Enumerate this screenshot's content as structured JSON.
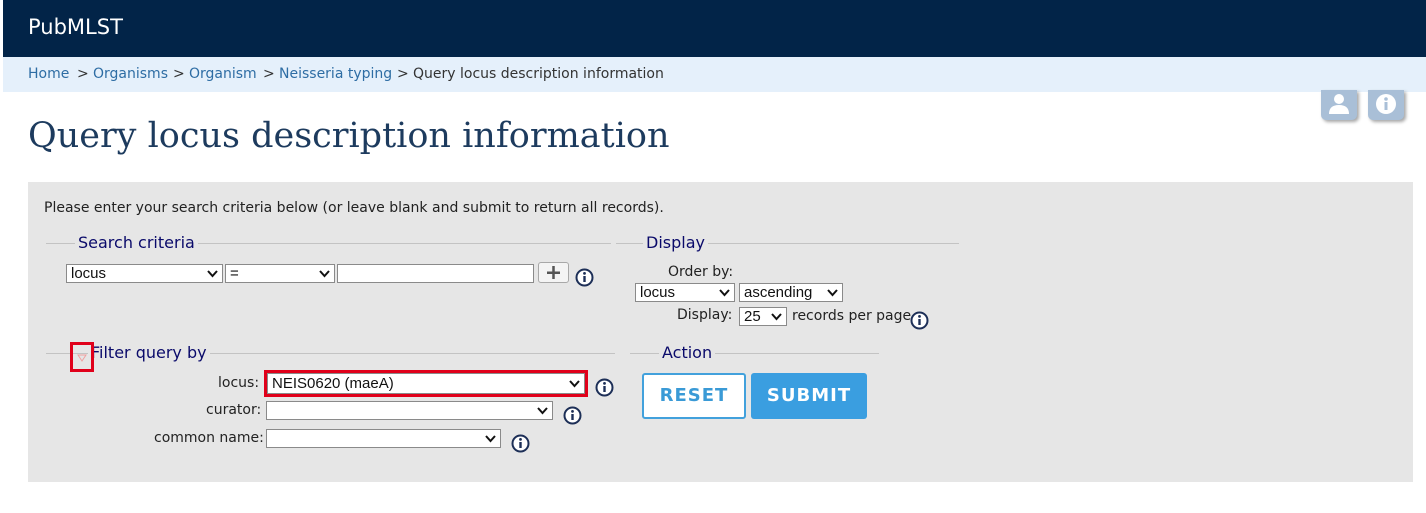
{
  "header": {
    "site_name": "PubMLST"
  },
  "breadcrumb": {
    "items": [
      "Home",
      "Organisms",
      "Organism",
      "Neisseria typing"
    ],
    "separator": ">",
    "current": "Query locus description information"
  },
  "top_icons": [
    "user-icon",
    "info-icon"
  ],
  "page_title": "Query locus description information",
  "instructions": "Please enter your search criteria below (or leave blank and submit to return all records).",
  "search_criteria": {
    "legend": "Search criteria",
    "field_select": "locus",
    "operator_select": "=",
    "value_input": "",
    "add_button_icon": "plus-icon"
  },
  "display": {
    "legend": "Display",
    "order_by_label": "Order by:",
    "order_by_value": "locus",
    "direction_value": "ascending",
    "display_label": "Display:",
    "per_page_value": "25",
    "per_page_suffix": "records per page"
  },
  "filter": {
    "legend": "Filter query by",
    "locus_label": "locus:",
    "locus_value": "NEIS0620 (maeA)",
    "curator_label": "curator:",
    "curator_value": "",
    "common_name_label": "common name:",
    "common_name_value": ""
  },
  "action": {
    "legend": "Action",
    "reset_label": "RESET",
    "submit_label": "SUBMIT"
  },
  "colors": {
    "header_bg": "#022448",
    "breadcrumb_bg": "#e5f0fb",
    "link": "#2e6da4",
    "title": "#1d3b5e",
    "button": "#3a9ee0",
    "highlight": "#e0001a"
  }
}
